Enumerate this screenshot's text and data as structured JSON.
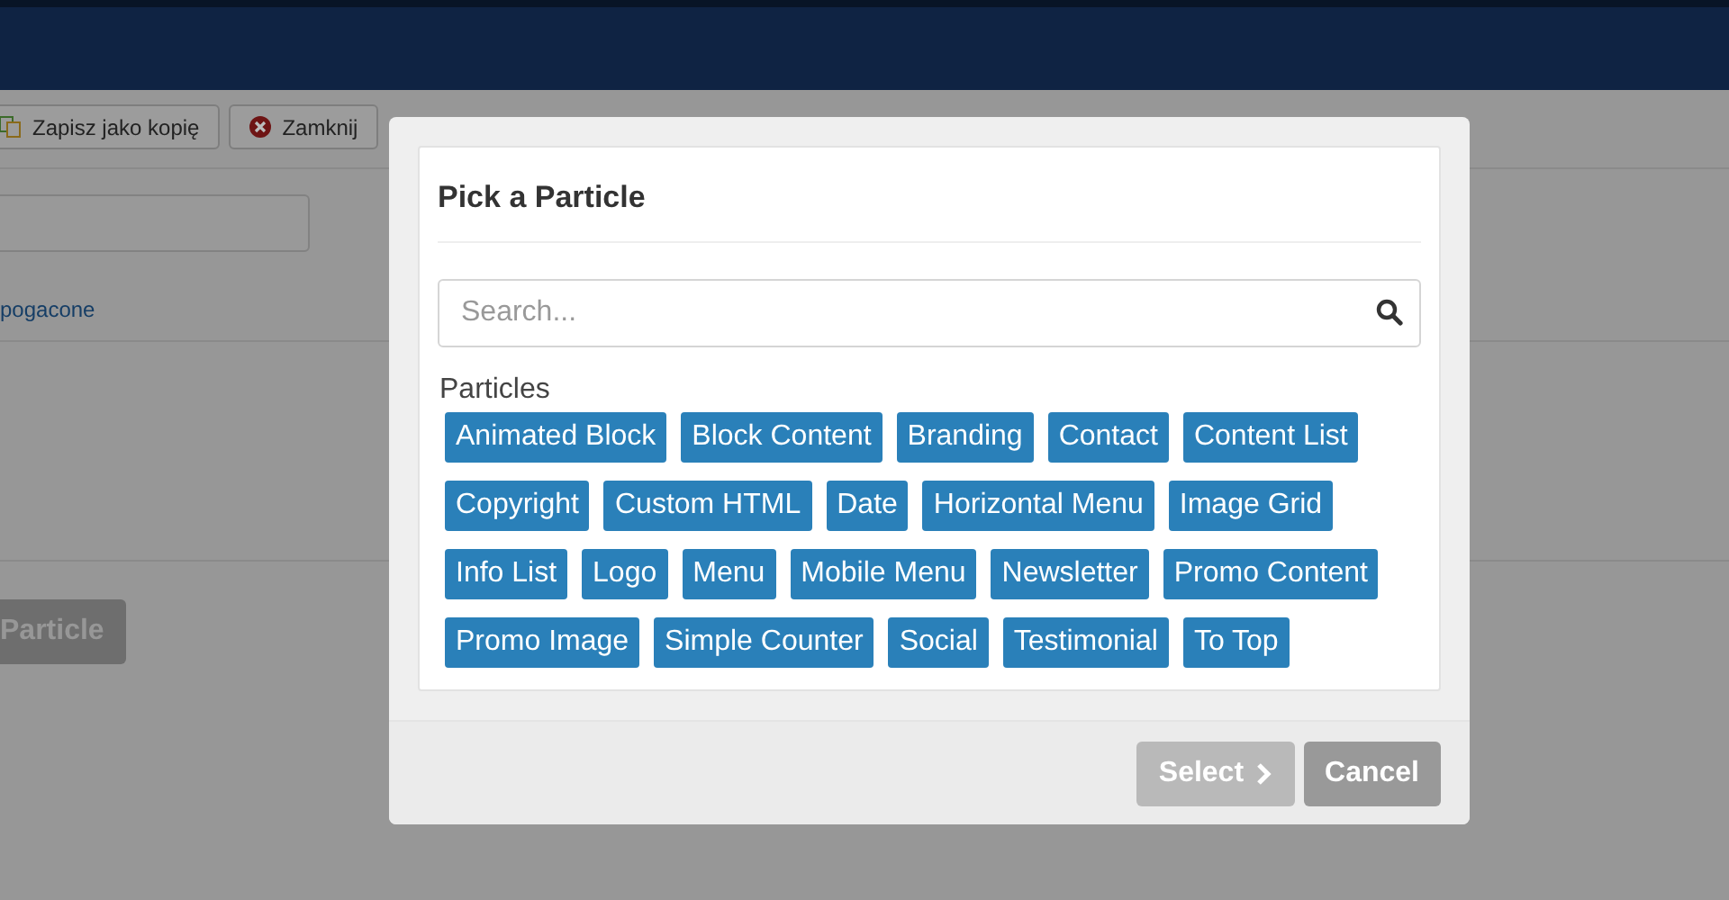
{
  "background": {
    "toolbar_buttons": [
      {
        "label": "Zapisz jako kopię",
        "kind": "copy"
      },
      {
        "label": "Zamknij",
        "kind": "close"
      }
    ],
    "link": "pogacone",
    "add_button": "Particle"
  },
  "modal": {
    "title": "Pick a Particle",
    "search": {
      "placeholder": "Search..."
    },
    "section_label": "Particles",
    "particles": [
      "Animated Block",
      "Block Content",
      "Branding",
      "Contact",
      "Content List",
      "Copyright",
      "Custom HTML",
      "Date",
      "Horizontal Menu",
      "Image Grid",
      "Info List",
      "Logo",
      "Menu",
      "Mobile Menu",
      "Newsletter",
      "Promo Content",
      "Promo Image",
      "Simple Counter",
      "Social",
      "Testimonial",
      "To Top"
    ],
    "buttons": [
      {
        "label": "Select",
        "kind": "select",
        "disabled": true
      },
      {
        "label": "Cancel",
        "kind": "cancel",
        "disabled": false
      }
    ]
  }
}
